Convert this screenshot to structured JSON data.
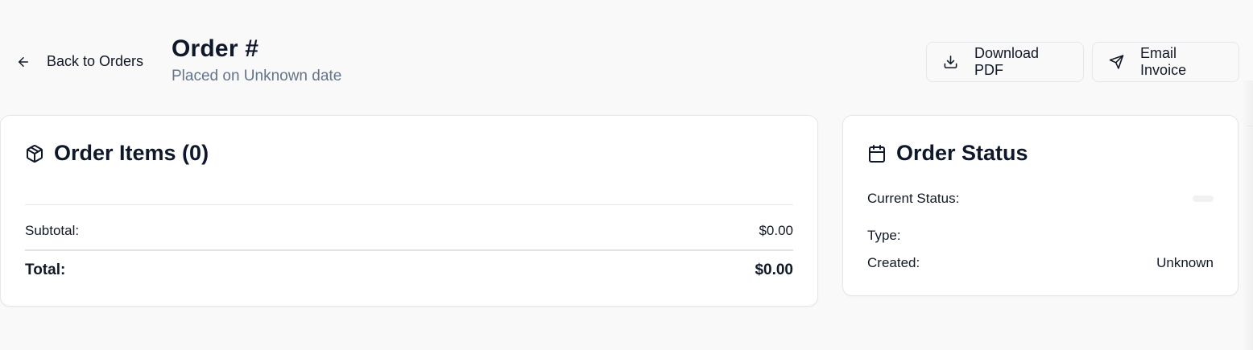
{
  "header": {
    "back_label": "Back to Orders",
    "title": "Order #",
    "subtitle": "Placed on Unknown date",
    "download_label": "Download PDF",
    "email_label": "Email Invoice"
  },
  "items_card": {
    "title": "Order Items (0)",
    "subtotal_label": "Subtotal:",
    "subtotal_value": "$0.00",
    "total_label": "Total:",
    "total_value": "$0.00"
  },
  "status_card": {
    "title": "Order Status",
    "current_status_label": "Current Status:",
    "type_label": "Type:",
    "created_label": "Created:",
    "created_value": "Unknown"
  },
  "icons": {
    "back": "arrow-left-icon",
    "download": "download-icon",
    "email": "send-icon",
    "items": "package-icon",
    "status": "calendar-icon"
  }
}
